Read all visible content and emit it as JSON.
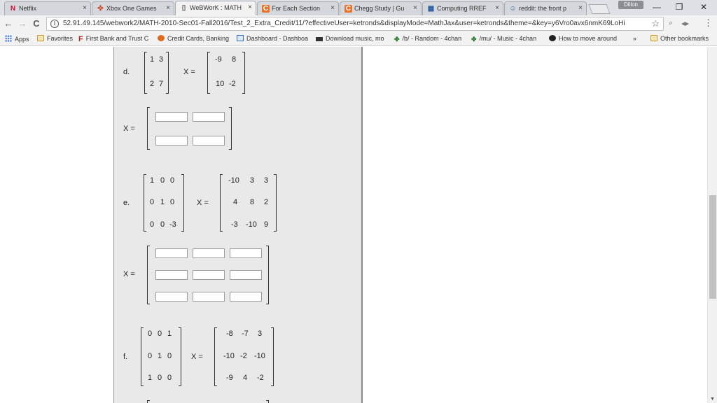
{
  "browser": {
    "tabs": [
      {
        "label": "Netflix",
        "icon": "N"
      },
      {
        "label": "Xbox One Games",
        "icon": "✜"
      },
      {
        "label": "WeBWorK : MATH",
        "icon": "▯"
      },
      {
        "label": "For Each Section",
        "icon": "C"
      },
      {
        "label": "Chegg Study | Gu",
        "icon": "C"
      },
      {
        "label": "Computing RREF",
        "icon": "▦"
      },
      {
        "label": "reddit: the front p",
        "icon": "☺"
      }
    ],
    "tab_close": "×",
    "user_badge": "Dillon",
    "window_controls": {
      "minimize": "—",
      "maximize": "❐",
      "close": "✕"
    },
    "nav": {
      "back": "←",
      "forward": "→",
      "reload": "C"
    },
    "url": "52.91.49.145/webwork2/MATH-2010-Sec01-Fall2016/Test_2_Extra_Credit/11/?effectiveUser=ketronds&displayMode=MathJax&user=ketronds&theme=&key=y6Vro0avx6nmK69LoHi",
    "info_icon": "i",
    "star": "☆",
    "menu": "⋮",
    "bookmarks": [
      {
        "label": "Apps"
      },
      {
        "label": "Favorites"
      },
      {
        "label": "First Bank and Trust C"
      },
      {
        "label": "Credit Cards, Banking"
      },
      {
        "label": "Dashboard - Dashboa"
      },
      {
        "label": "Download music, mo"
      },
      {
        "label": "/b/ - Random - 4chan"
      },
      {
        "label": "/mu/ - Music - 4chan"
      },
      {
        "label": "How to move around"
      }
    ],
    "bookmarks_more": "»",
    "other_bookmarks": "Other bookmarks"
  },
  "problems": {
    "x_equals": "X =",
    "d": {
      "label": "d.",
      "A": [
        [
          "1",
          "3"
        ],
        [
          "2",
          "7"
        ]
      ],
      "B": [
        [
          "-9",
          "8"
        ],
        [
          "10",
          "-2"
        ]
      ]
    },
    "e": {
      "label": "e.",
      "A": [
        [
          "1",
          "0",
          "0"
        ],
        [
          "0",
          "1",
          "0"
        ],
        [
          "0",
          "0",
          "-3"
        ]
      ],
      "B": [
        [
          "-10",
          "3",
          "3"
        ],
        [
          "4",
          "8",
          "2"
        ],
        [
          "-3",
          "-10",
          "9"
        ]
      ]
    },
    "f": {
      "label": "f.",
      "A": [
        [
          "0",
          "0",
          "1"
        ],
        [
          "0",
          "1",
          "0"
        ],
        [
          "1",
          "0",
          "0"
        ]
      ],
      "B": [
        [
          "-8",
          "-7",
          "3"
        ],
        [
          "-10",
          "-2",
          "-10"
        ],
        [
          "-9",
          "4",
          "-2"
        ]
      ]
    }
  },
  "colors": {
    "panel_bg": "#e9e9e9",
    "tab_bg": "#dee1e5"
  }
}
